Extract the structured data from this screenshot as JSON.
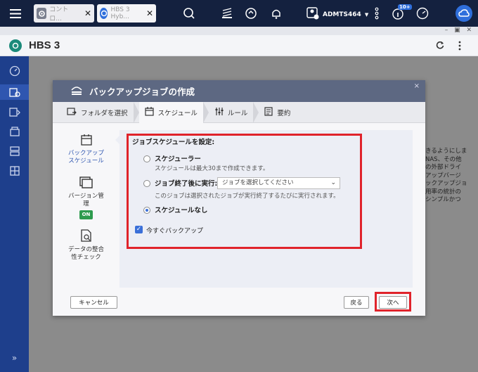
{
  "topbar": {
    "tabs": [
      {
        "label": "コントロ..."
      },
      {
        "label": "HBS 3 Hyb..."
      }
    ],
    "user": "ADMTS464",
    "notification_badge": "10+"
  },
  "app": {
    "title": "HBS 3"
  },
  "dialog": {
    "title": "バックアップジョブの作成",
    "close": "×",
    "steps": [
      "フォルダを選択",
      "スケジュール",
      "ルール",
      "要約"
    ],
    "nav": {
      "schedule": "バックアップスケジュール",
      "version": "バージョン管理",
      "version_badge": "ON",
      "integrity": "データの整合性チェック"
    },
    "section_title": "ジョブスケジュールを設定:",
    "options": {
      "scheduler_label": "スケジューラー",
      "scheduler_sub": "スケジュールは最大30まで作成できます。",
      "after_job_label": "ジョブ終了後に実行:",
      "after_job_select": "ジョブを選択してください",
      "after_job_sub": "このジョブは選択されたジョブが実行終了するたびに実行されます。",
      "none_label": "スケジュールなし",
      "selected": "none"
    },
    "backup_now": "今すぐバックアップ",
    "buttons": {
      "cancel": "キャンセル",
      "back": "戻る",
      "next": "次へ"
    }
  },
  "background_text": [
    "きるようにしま",
    "NAS、その他",
    "の外部ドライ",
    "アップバージ",
    "ックアップジョ",
    "用率の統計の",
    "シンプルかつ"
  ],
  "colors": {
    "accent": "#3a6fd8",
    "highlight_box": "#e0232b",
    "sidebar": "#1e3f8c",
    "badge_on": "#2e9b4e"
  }
}
